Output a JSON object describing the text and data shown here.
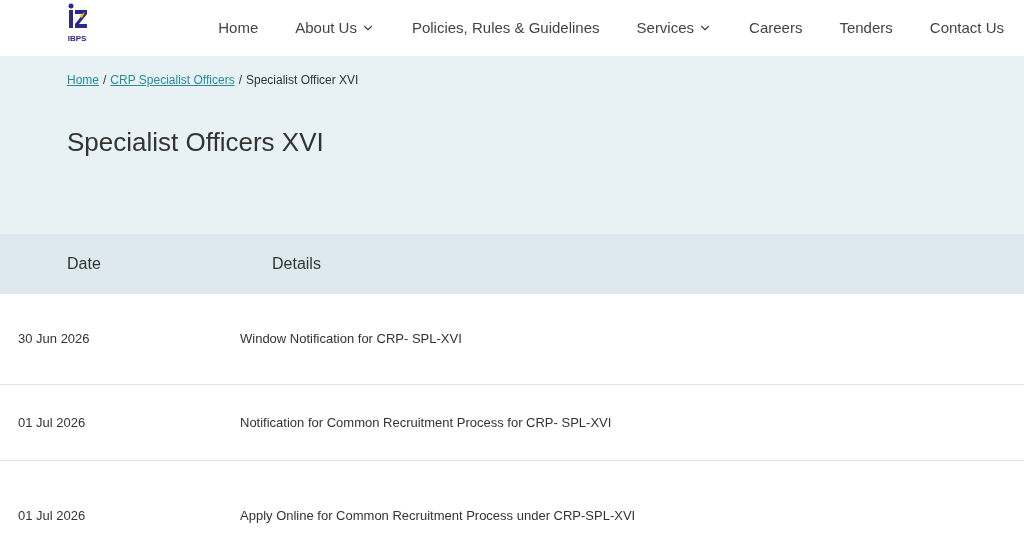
{
  "logo": {
    "text": "IBPS"
  },
  "nav": [
    {
      "label": "Home",
      "dropdown": false
    },
    {
      "label": "About Us",
      "dropdown": true
    },
    {
      "label": "Policies, Rules & Guidelines",
      "dropdown": false
    },
    {
      "label": "Services",
      "dropdown": true
    },
    {
      "label": "Careers",
      "dropdown": false
    },
    {
      "label": "Tenders",
      "dropdown": false
    },
    {
      "label": "Contact Us",
      "dropdown": false
    }
  ],
  "breadcrumb_separator": "/",
  "breadcrumb": [
    {
      "label": "Home",
      "link": true
    },
    {
      "label": "CRP Specialist Officers",
      "link": true
    },
    {
      "label": "Specialist Officer XVI",
      "link": false
    }
  ],
  "title": "Specialist Officers XVI",
  "table": {
    "columns": [
      "Date",
      "Details"
    ],
    "rows": [
      {
        "date": "30 Jun 2026",
        "details": "Window Notification for CRP- SPL-XVI"
      },
      {
        "date": "01 Jul 2026",
        "details": "Notification for Common Recruitment Process for CRP- SPL-XVI"
      },
      {
        "date": "01 Jul 2026",
        "details": "Apply Online for Common Recruitment Process under CRP-SPL-XVI"
      }
    ]
  }
}
